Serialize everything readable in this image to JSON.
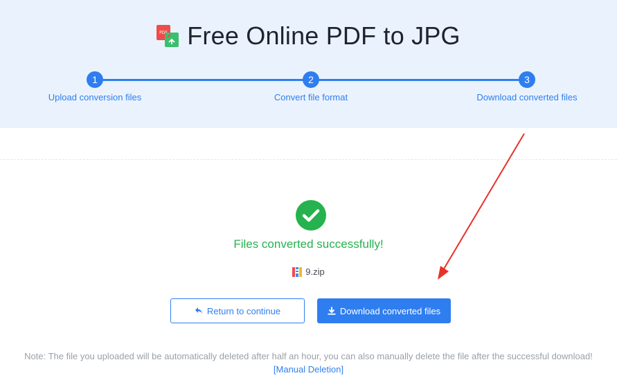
{
  "header": {
    "title": "Free Online PDF to JPG",
    "icon_text": "PDF"
  },
  "steps": [
    {
      "number": "1",
      "label": "Upload conversion files"
    },
    {
      "number": "2",
      "label": "Convert file format"
    },
    {
      "number": "3",
      "label": "Download converted files"
    }
  ],
  "result": {
    "message": "Files converted successfully!",
    "file_name": "9.zip"
  },
  "buttons": {
    "return_label": "Return to continue",
    "download_label": "Download converted files"
  },
  "note": {
    "text": "Note: The file you uploaded will be automatically deleted after half an hour, you can also manually delete the file after the successful download!",
    "link": "[Manual Deletion]"
  },
  "colors": {
    "accent": "#2f7ef0",
    "success": "#26b24e",
    "header_bg": "#eaf3fd",
    "annotation_arrow": "#e8302a"
  }
}
